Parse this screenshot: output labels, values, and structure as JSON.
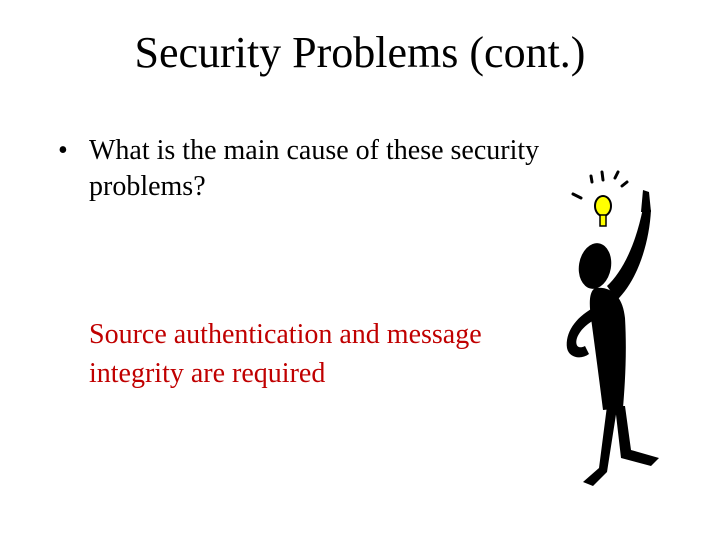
{
  "slide": {
    "title": "Security Problems (cont.)",
    "bullet": {
      "marker": "•",
      "text": "What is the main cause of these security problems?"
    },
    "answer": {
      "text": "Source authentication and message integrity are required",
      "color": "#c00000"
    },
    "illustration": {
      "icon": "idea-person-icon",
      "bulb_color": "#ffff00"
    }
  }
}
